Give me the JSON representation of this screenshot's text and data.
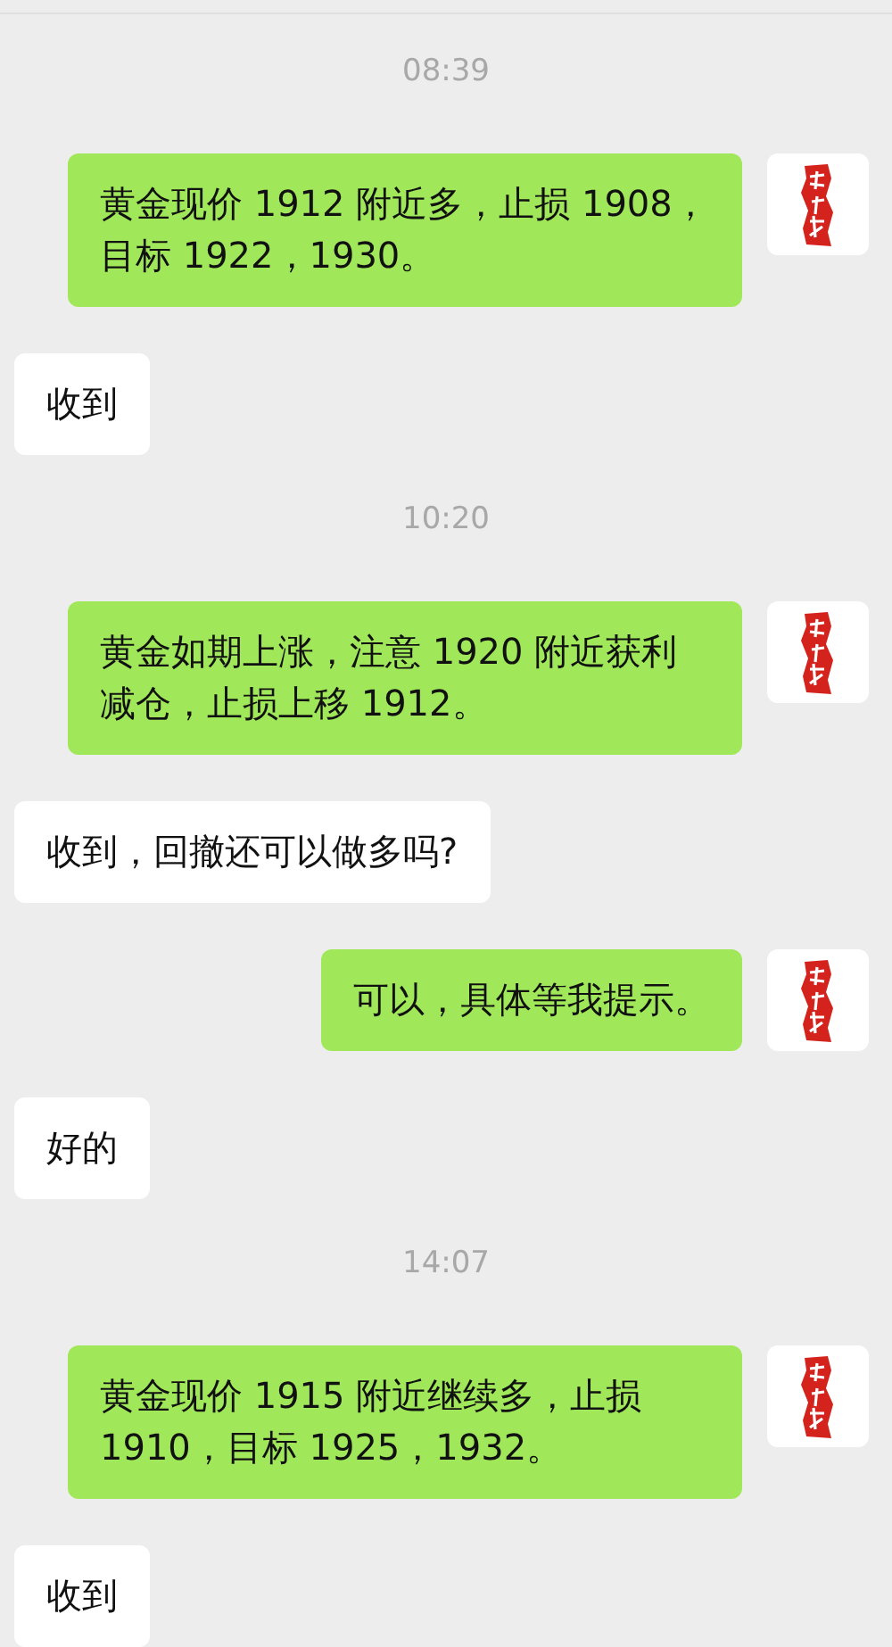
{
  "messages": [
    {
      "kind": "time",
      "text": "08:39"
    },
    {
      "kind": "sent",
      "text": "黄金现价 1912 附近多，止损 1908，目标 1922，1930。"
    },
    {
      "kind": "received",
      "text": "收到"
    },
    {
      "kind": "time",
      "text": "10:20"
    },
    {
      "kind": "sent",
      "text": "黄金如期上涨，注意 1920 附近获利减仓，止损上移 1912。"
    },
    {
      "kind": "received",
      "text": "收到，回撤还可以做多吗?"
    },
    {
      "kind": "sent",
      "text": "可以，具体等我提示。"
    },
    {
      "kind": "received",
      "text": "好的"
    },
    {
      "kind": "time",
      "text": "14:07"
    },
    {
      "kind": "sent",
      "text": "黄金现价 1915 附近继续多，止损 1910，目标 1925，1932。"
    },
    {
      "kind": "received",
      "text": "收到"
    }
  ]
}
